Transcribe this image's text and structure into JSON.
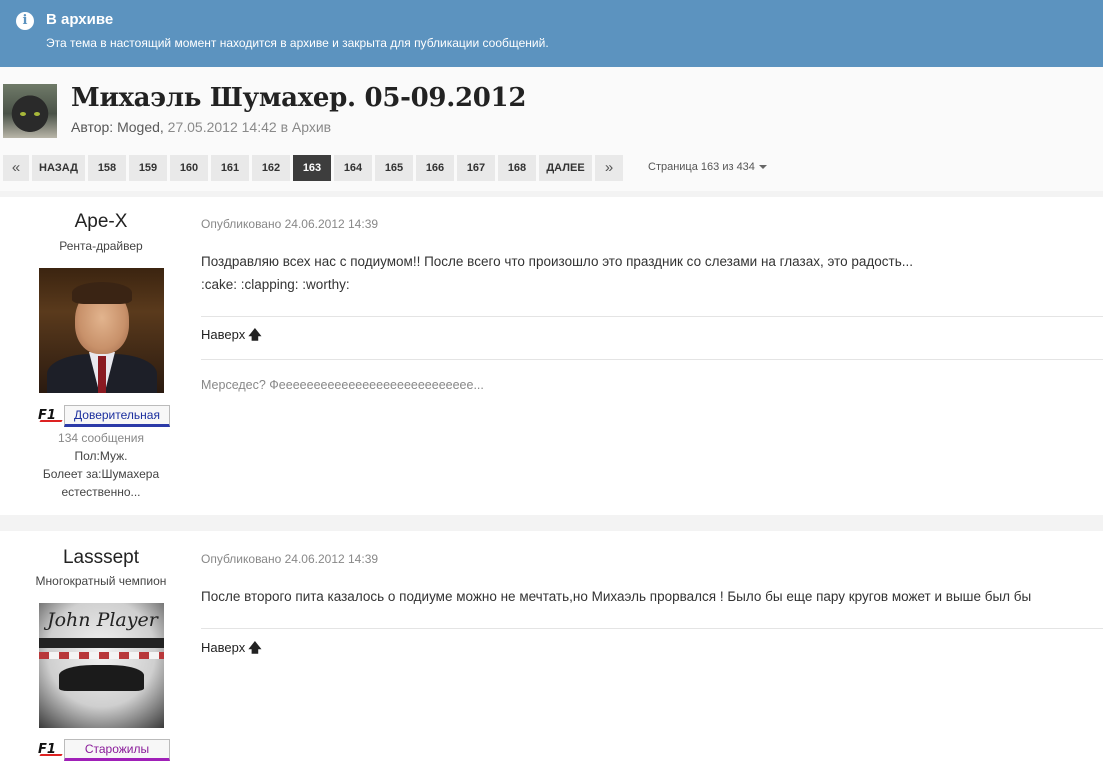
{
  "archive": {
    "title": "В архиве",
    "text": "Эта тема в настоящий момент находится в архиве и закрыта для публикации сообщений.",
    "icon": "info-icon"
  },
  "topic": {
    "title": "Михаэль Шумахер. 05-09.2012",
    "author_prefix": "Автор:",
    "author": "Moged,",
    "date": "27.05.2012 14:42",
    "in_word": "в",
    "forum": "Архив"
  },
  "pagination": {
    "first": "«",
    "prev": "НАЗАД",
    "pages": [
      "158",
      "159",
      "160",
      "161",
      "162",
      "163",
      "164",
      "165",
      "166",
      "167",
      "168"
    ],
    "current": "163",
    "next": "ДАЛЕЕ",
    "last": "»",
    "page_info": "Страница 163 из 434"
  },
  "posts": [
    {
      "author": "Ape-X",
      "rank": "Рента-драйвер",
      "group": "Доверительная",
      "group_color": "#1b2f9e",
      "posts_count": "134 сообщения",
      "field1": "Пол:Муж.",
      "field2": "Болеет за:Шумахера естественно...",
      "date": "Опубликовано 24.06.2012 14:39",
      "body_line1": "Поздравляю всех нас с подиумом!! После всего что произошло это праздник со слезами на глазах, это радость...",
      "body_line2": ":cake: :clapping: :worthy:",
      "to_top": "Наверх",
      "signature": "Мерседес? Фееееееееееееееееееееееееееее..."
    },
    {
      "author": "Lasssept",
      "rank": "Многократный чемпион",
      "group": "Старожилы",
      "group_color": "#8a1b9a",
      "date": "Опубликовано 24.06.2012 14:39",
      "body_line1": "После второго пита казалось о подиуме можно не мечтать,но Михаэль прорвался ! Было бы еще пару кругов может и выше был бы",
      "to_top": "Наверх",
      "photo_text": "John Player"
    }
  ]
}
